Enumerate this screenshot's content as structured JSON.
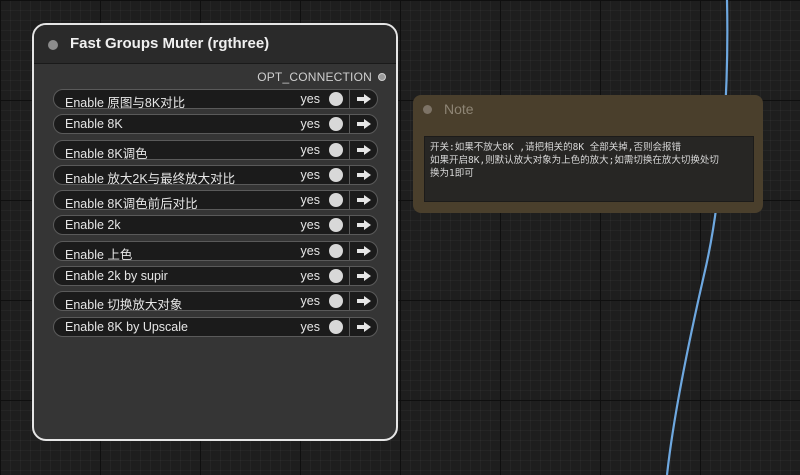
{
  "node": {
    "title": "Fast Groups Muter (rgthree)",
    "output_label": "OPT_CONNECTION",
    "toggles": [
      {
        "label": "Enable 原图与8K对比",
        "value": "yes"
      },
      {
        "label": "Enable 8K",
        "value": "yes"
      },
      {
        "label": "Enable 8K调色",
        "value": "yes"
      },
      {
        "label": "Enable 放大2K与最终放大对比",
        "value": "yes"
      },
      {
        "label": "Enable 8K调色前后对比",
        "value": "yes"
      },
      {
        "label": "Enable 2k",
        "value": "yes"
      },
      {
        "label": "Enable 上色",
        "value": "yes"
      },
      {
        "label": "Enable 2k by supir",
        "value": "yes"
      },
      {
        "label": "Enable 切换放大对象",
        "value": "yes"
      },
      {
        "label": "Enable 8K by Upscale",
        "value": "yes"
      }
    ]
  },
  "note": {
    "title": "Note",
    "lines": [
      "开关:如果不放大8K ,请把相关的8K 全部关掉,否则会报错",
      "如果开启8K,则默认放大对象为上色的放大;如需切换在放大切换处切",
      "换为1即可"
    ]
  },
  "colors": {
    "canvas_bg": "#1e1e1e",
    "node_border": "#e6e6e6",
    "wire": "#6ea8e0",
    "note_bg": "#4a3f2c"
  },
  "icons": {
    "node_status": "status-dot-icon",
    "output_slot": "output-slot-icon",
    "toggle_nav": "arrow-right-icon"
  }
}
